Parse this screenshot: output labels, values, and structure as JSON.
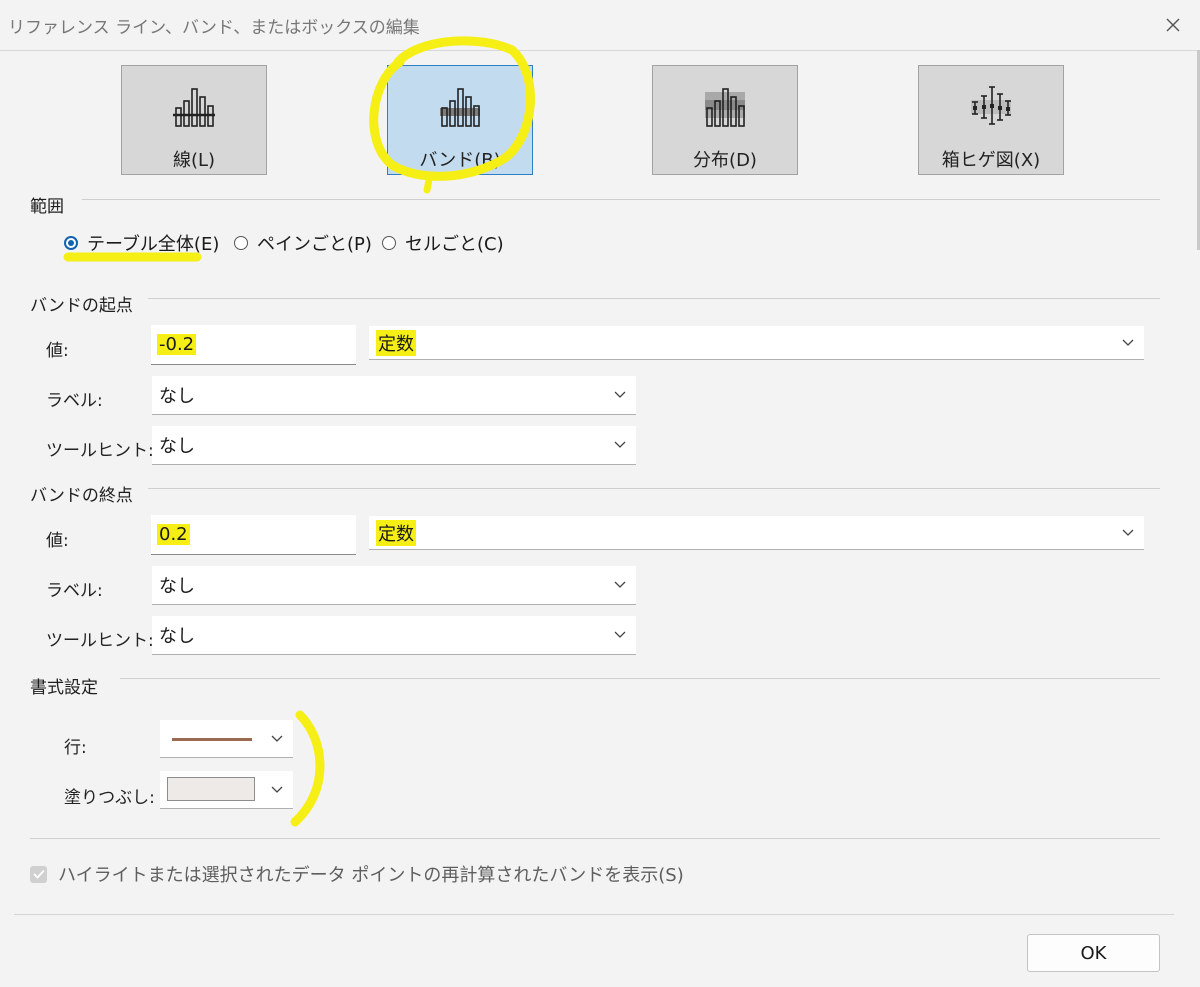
{
  "window": {
    "title": "リファレンス ライン、バンド、またはボックスの編集"
  },
  "type_buttons": [
    {
      "label": "線(L)",
      "icon": "bar-chart-line-icon",
      "selected": false
    },
    {
      "label": "バンド(B)",
      "icon": "bar-chart-band-icon",
      "selected": true
    },
    {
      "label": "分布(D)",
      "icon": "bar-chart-distribution-icon",
      "selected": false
    },
    {
      "label": "箱ヒゲ図(X)",
      "icon": "box-plot-icon",
      "selected": false
    }
  ],
  "scope": {
    "title": "範囲",
    "options": [
      {
        "label": "テーブル全体(E)",
        "checked": true
      },
      {
        "label": "ペインごと(P)",
        "checked": false
      },
      {
        "label": "セルごと(C)",
        "checked": false
      }
    ]
  },
  "band_from": {
    "title": "バンドの起点",
    "value_label": "値:",
    "value": "-0.2",
    "value_type": "定数",
    "label_label": "ラベル:",
    "label_value": "なし",
    "tooltip_label": "ツールヒント:",
    "tooltip_value": "なし"
  },
  "band_to": {
    "title": "バンドの終点",
    "value_label": "値:",
    "value": "0.2",
    "value_type": "定数",
    "label_label": "ラベル:",
    "label_value": "なし",
    "tooltip_label": "ツールヒント:",
    "tooltip_value": "なし"
  },
  "formatting": {
    "title": "書式設定",
    "line_label": "行:",
    "fill_label": "塗りつぶし:",
    "line_color": "#9a6b52",
    "fill_color": "#eeeae8"
  },
  "recalc_checkbox": {
    "label": "ハイライトまたは選択されたデータ ポイントの再計算されたバンドを表示(S)",
    "checked": true,
    "disabled": true
  },
  "ok_button": {
    "label": "OK"
  },
  "colors": {
    "selected_bg": "#c3dbef",
    "selected_border": "#2f7fc4",
    "highlight": "#f6ef16",
    "radio_accent": "#0f62b0"
  }
}
